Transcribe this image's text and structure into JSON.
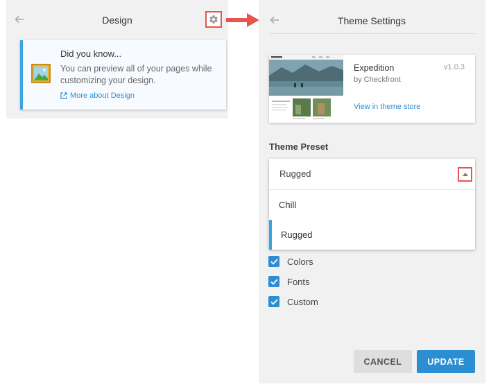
{
  "left_panel": {
    "title": "Design",
    "tip": {
      "heading": "Did you know...",
      "text": "You can preview all of your pages while customizing your design.",
      "link": "More about Design"
    }
  },
  "right_panel": {
    "title": "Theme Settings",
    "theme": {
      "name": "Expedition",
      "author": "by Checkfront",
      "version": "v1.0.3",
      "store_link": "View in theme store"
    },
    "preset_label": "Theme Preset",
    "preset": {
      "selected": "Rugged",
      "options": [
        "Chill",
        "Rugged"
      ]
    },
    "checkboxes": [
      {
        "label": "Colors",
        "checked": true
      },
      {
        "label": "Fonts",
        "checked": true
      },
      {
        "label": "Custom",
        "checked": true
      }
    ],
    "cancel_label": "CANCEL",
    "update_label": "UPDATE"
  },
  "colors": {
    "accent": "#2b8ed3",
    "highlight": "#e8554e",
    "panel_bg": "#f1f1f1"
  }
}
